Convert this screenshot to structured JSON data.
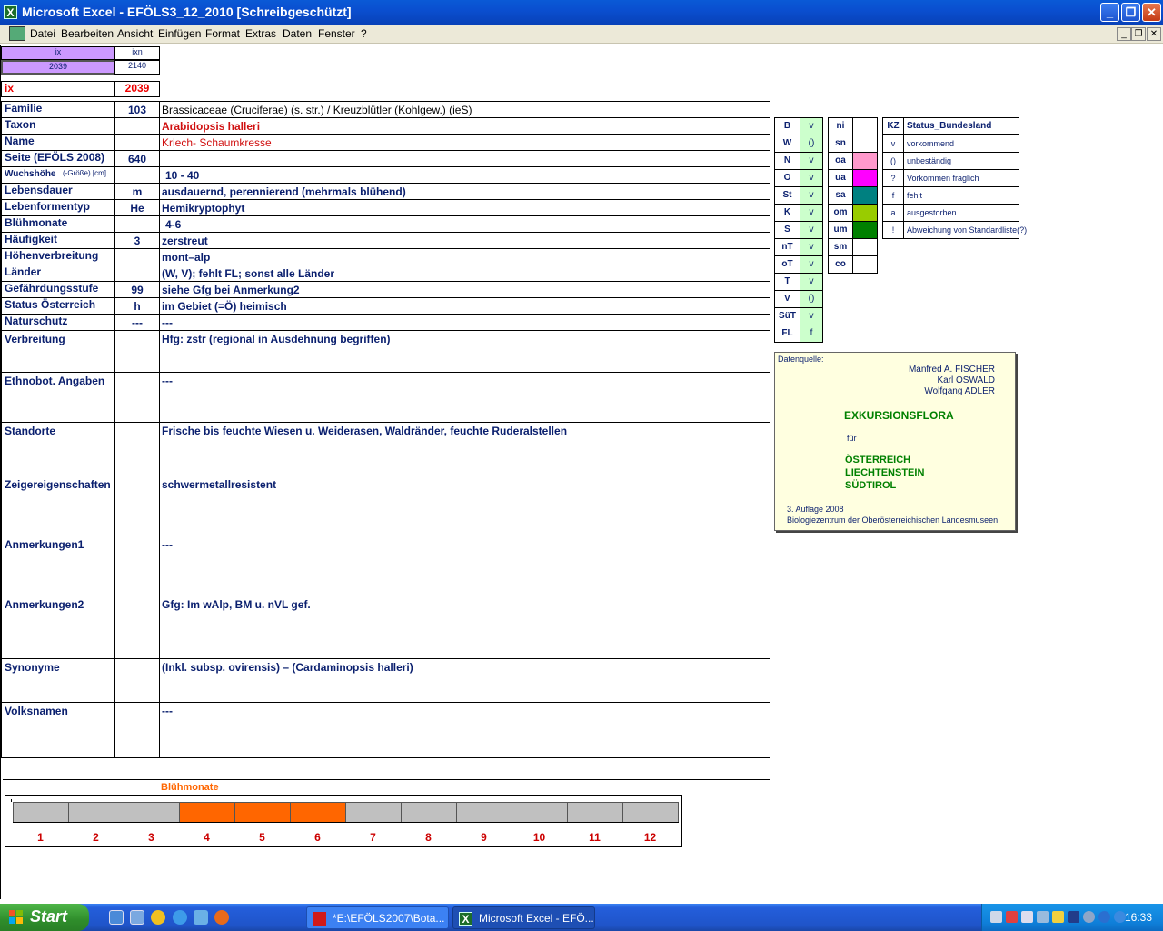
{
  "window": {
    "title": "Microsoft Excel - EFÖLS3_12_2010  [Schreibgeschützt]",
    "app_icon": "X",
    "buttons": [
      "_",
      "❐",
      "✕"
    ],
    "mdi_buttons": [
      "_",
      "❐",
      "✕"
    ]
  },
  "menu": [
    "Datei",
    "Bearbeiten",
    "Ansicht",
    "Einfügen",
    "Format",
    "Extras",
    "Daten",
    "Fenster",
    "?"
  ],
  "top_cells": {
    "ix_header": "ix",
    "ixn_header": "ixn",
    "ix_value": "2039",
    "ixn_value": "2140",
    "ix_label": "ix",
    "ix_big": "2039"
  },
  "rows": [
    {
      "label": "Familie",
      "code": "103",
      "value": "Brassicaceae (Cruciferae) (s. str.)  /  Kreuzblütler (Kohlgew.) (ieS)"
    },
    {
      "label": "Taxon",
      "code": "",
      "value": "Arabidopsis halleri"
    },
    {
      "label": "Name",
      "code": "",
      "value": "Kriech- Schaumkresse"
    },
    {
      "label": "Seite (EFÖLS 2008)",
      "code": "640",
      "value": ""
    },
    {
      "label": "Wuchshöhe",
      "label_suffix": "(-Größe) [cm]",
      "code": "",
      "value": "10 - 40"
    },
    {
      "label": "Lebensdauer",
      "code": "m",
      "value": "ausdauernd, perennierend (mehrmals blühend)"
    },
    {
      "label": "Lebenformentyp",
      "code": "He",
      "value": "Hemikryptophyt"
    },
    {
      "label": "Blühmonate",
      "code": "",
      "value": "4-6"
    },
    {
      "label": "Häufigkeit",
      "code": "3",
      "value": "zerstreut"
    },
    {
      "label": "Höhenverbreitung",
      "code": "",
      "value": "mont–alp"
    },
    {
      "label": "Länder",
      "code": "",
      "value": "(W, V); fehlt FL; sonst alle Länder"
    },
    {
      "label": "Gefährdungsstufe",
      "code": "99",
      "value": "siehe Gfg bei Anmerkung2"
    },
    {
      "label": "Status Österreich",
      "code": "h",
      "value": "im Gebiet (=Ö) heimisch"
    },
    {
      "label": "Naturschutz",
      "code": "---",
      "value": "---"
    },
    {
      "label": "Verbreitung",
      "code": "",
      "value": "Hfg:  zstr (regional in Ausdehnung begriffen)"
    },
    {
      "label": "Ethnobot. Angaben",
      "code": "",
      "value": "---"
    },
    {
      "label": "Standorte",
      "code": "",
      "value": "Frische bis feuchte Wiesen u. Weiderasen, Waldränder, feuchte Ruderalstellen"
    },
    {
      "label": "Zeigereigenschaften",
      "code": "",
      "value": "schwermetallresistent"
    },
    {
      "label": "Anmerkungen1",
      "code": "",
      "value": "---"
    },
    {
      "label": "Anmerkungen2",
      "code": "",
      "value": "Gfg:  Im wAlp, BM u. nVL gef."
    },
    {
      "label": "Synonyme",
      "code": "",
      "value": "(Inkl. subsp. ovirensis) – (Cardaminopsis halleri)"
    },
    {
      "label": "Volksnamen",
      "code": "",
      "value": "---"
    }
  ],
  "laender": [
    {
      "k": "B",
      "v": "v"
    },
    {
      "k": "W",
      "v": "()"
    },
    {
      "k": "N",
      "v": "v"
    },
    {
      "k": "O",
      "v": "v"
    },
    {
      "k": "St",
      "v": "v"
    },
    {
      "k": "K",
      "v": "v"
    },
    {
      "k": "S",
      "v": "v"
    },
    {
      "k": "nT",
      "v": "v"
    },
    {
      "k": "oT",
      "v": "v"
    },
    {
      "k": "T",
      "v": "v"
    },
    {
      "k": "V",
      "v": "()"
    },
    {
      "k": "SüT",
      "v": "v"
    },
    {
      "k": "FL",
      "v": "f"
    }
  ],
  "hoehenstufen": [
    {
      "k": "ni",
      "color": ""
    },
    {
      "k": "sn",
      "color": ""
    },
    {
      "k": "oa",
      "color": "#ff99cc"
    },
    {
      "k": "ua",
      "color": "#ff00ff"
    },
    {
      "k": "sa",
      "color": "#008080"
    },
    {
      "k": "om",
      "color": "#99cc00"
    },
    {
      "k": "um",
      "color": "#008000"
    },
    {
      "k": "sm",
      "color": ""
    },
    {
      "k": "co",
      "color": ""
    }
  ],
  "legend": {
    "header_kz": "KZ",
    "header_status": "Status_Bundesland",
    "items": [
      {
        "kz": "v",
        "text": "vorkommend"
      },
      {
        "kz": "()",
        "text": "unbeständig"
      },
      {
        "kz": "?",
        "text": "Vorkommen fraglich"
      },
      {
        "kz": "f",
        "text": "fehlt"
      },
      {
        "kz": "a",
        "text": "ausgestorben"
      },
      {
        "kz": "!",
        "text": "Abweichung von Standardliste(?)"
      }
    ]
  },
  "source": {
    "label": "Datenquelle:",
    "authors": [
      "Manfred A. FISCHER",
      "Karl OSWALD",
      "Wolfgang ADLER"
    ],
    "title": "EXKURSIONSFLORA",
    "fuer": "für",
    "countries": [
      "ÖSTERREICH",
      "LIECHTENSTEIN",
      "SÜDTIROL"
    ],
    "edition": "3. Auflage 2008",
    "publisher": "Biologiezentrum der Oberösterreichischen Landesmuseen"
  },
  "bloom": {
    "title": "Blühmonate",
    "months": [
      "1",
      "2",
      "3",
      "4",
      "5",
      "6",
      "7",
      "8",
      "9",
      "10",
      "11",
      "12"
    ],
    "active": [
      4,
      5,
      6
    ],
    "active_color": "#ff6600",
    "inactive_color": "#c0c0c0"
  },
  "taskbar": {
    "start": "Start",
    "tasks": [
      "*E:\\EFÖLS2007\\Bota...",
      "Microsoft Excel - EFÖ..."
    ],
    "clock": "16:33"
  }
}
